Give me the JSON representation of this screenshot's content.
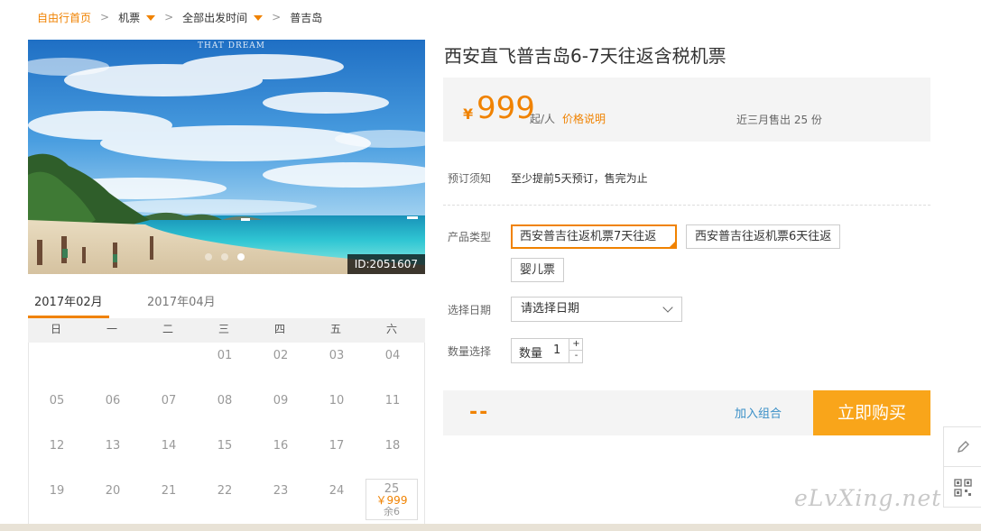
{
  "breadcrumb": {
    "home": "自由行首页",
    "items": [
      "机票",
      "全部出发时间",
      "普吉岛"
    ],
    "separator": ">"
  },
  "hero": {
    "brand": "THAT DREAM",
    "brand_sub": "",
    "image_id": "ID:2051607",
    "carousel_total": 3,
    "carousel_active": 3
  },
  "calendar": {
    "tabs": [
      "2017年02月",
      "2017年04月"
    ],
    "weekdays": [
      "日",
      "一",
      "二",
      "三",
      "四",
      "五",
      "六"
    ],
    "weeks": [
      [
        "",
        "",
        "",
        "01",
        "02",
        "03",
        "04"
      ],
      [
        "05",
        "06",
        "07",
        "08",
        "09",
        "10",
        "11"
      ],
      [
        "12",
        "13",
        "14",
        "15",
        "16",
        "17",
        "18"
      ],
      [
        "19",
        "20",
        "21",
        "22",
        "23",
        "24",
        "25"
      ]
    ],
    "available": {
      "day": "25",
      "price": "￥999",
      "remain": "余6"
    }
  },
  "product": {
    "title": "西安直飞普吉岛6-7天往返含税机票",
    "currency": "¥",
    "price": "999",
    "price_unit": "起/人",
    "price_note": "价格说明",
    "sold": "近三月售出 25 份"
  },
  "booking": {
    "notice_label": "预订须知",
    "notice_text": "至少提前5天预订，售完为止",
    "type_label": "产品类型",
    "types": [
      "西安普吉往返机票7天往返",
      "西安普吉往返机票6天往返",
      "婴儿票"
    ],
    "date_label": "选择日期",
    "date_placeholder": "请选择日期",
    "qty_label": "数量选择",
    "qty_inner_label": "数量",
    "qty_value": "1",
    "plus": "+",
    "minus": "-"
  },
  "buy": {
    "total": "--",
    "combo": "加入组合",
    "buy_now": "立即购买"
  },
  "watermark": "eLvXing.net",
  "colors": {
    "accent": "#f08200",
    "buy_button": "#f9a51a",
    "link": "#3a8fc7"
  }
}
